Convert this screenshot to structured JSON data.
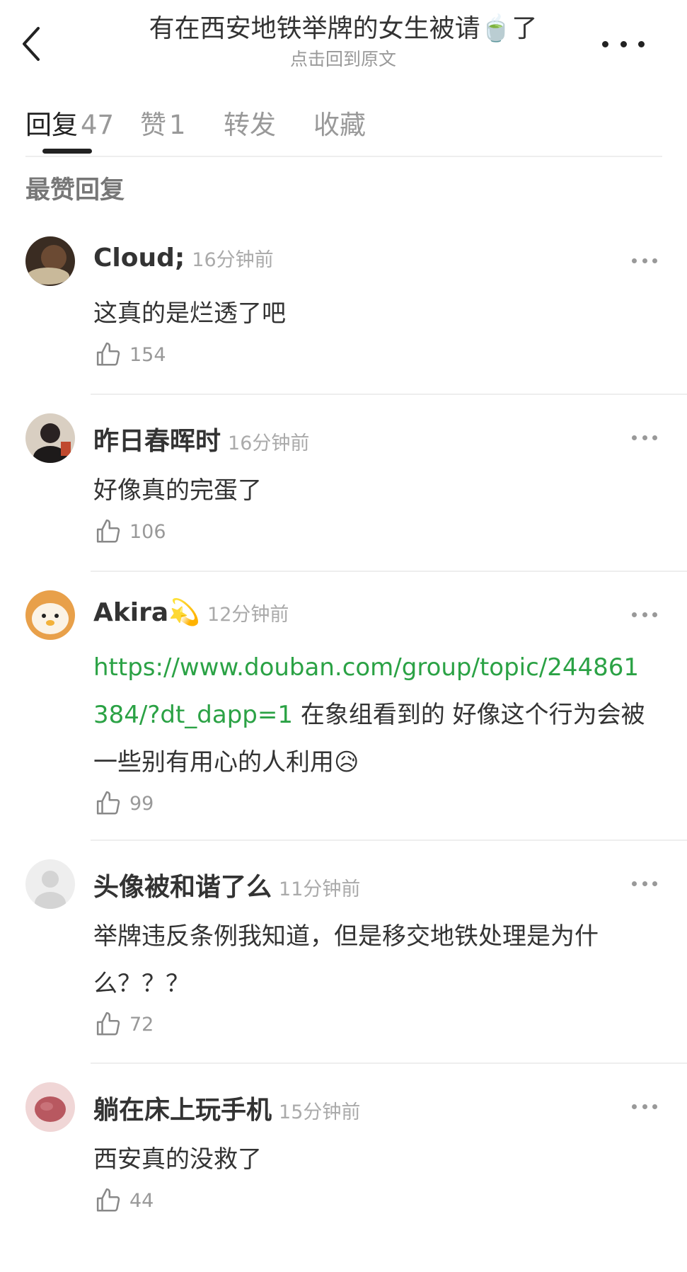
{
  "header": {
    "title": "有在西安地铁举牌的女生被请🍵了",
    "subtitle": "点击回到原文"
  },
  "tabs": [
    {
      "label": "回复",
      "count": "47"
    },
    {
      "label": "赞",
      "count": "1"
    },
    {
      "label": "转发",
      "count": ""
    },
    {
      "label": "收藏",
      "count": ""
    }
  ],
  "section_title": "最赞回复",
  "comments": [
    {
      "username": "Cloud;",
      "time": "16分钟前",
      "text": "这真的是烂透了吧",
      "likes": "154"
    },
    {
      "username": "昨日春晖时",
      "time": "16分钟前",
      "text": "好像真的完蛋了",
      "likes": "106"
    },
    {
      "username": "Akira💫",
      "time": "12分钟前",
      "link": "https://www.douban.com/group/topic/244861384/?dt_dapp=1",
      "text": " 在象组看到的 好像这个行为会被一些别有用心的人利用😥",
      "likes": "99"
    },
    {
      "username": "头像被和谐了么",
      "time": "11分钟前",
      "text": "举牌违反条例我知道，但是移交地铁处理是为什么？？？",
      "likes": "72"
    },
    {
      "username": "躺在床上玩手机",
      "time": "15分钟前",
      "text": "西安真的没救了",
      "likes": "44"
    }
  ],
  "colors": {
    "link": "#2ba245",
    "muted": "#999999",
    "text": "#333333"
  }
}
